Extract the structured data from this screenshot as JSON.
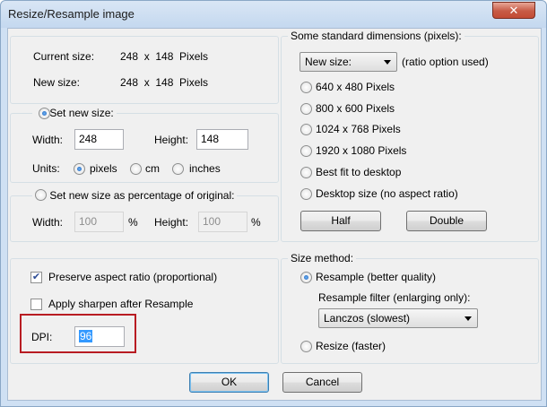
{
  "window": {
    "title": "Resize/Resample image",
    "close_label": "✕"
  },
  "size_info": {
    "current_label": "Current size:",
    "current_value": "248  x  148  Pixels",
    "new_label": "New size:",
    "new_value": "248  x  148  Pixels"
  },
  "set_new_size": {
    "title": "Set new size:",
    "width_label": "Width:",
    "width_value": "248",
    "height_label": "Height:",
    "height_value": "148",
    "units_label": "Units:",
    "units": [
      "pixels",
      "cm",
      "inches"
    ],
    "selected_unit": "pixels"
  },
  "percentage": {
    "title": "Set new size as percentage of original:",
    "width_label": "Width:",
    "width_value": "100",
    "height_label": "Height:",
    "height_value": "100",
    "percent_sign": "%"
  },
  "options": {
    "preserve_label": "Preserve aspect ratio (proportional)",
    "preserve_checked": true,
    "sharpen_label": "Apply sharpen after Resample",
    "sharpen_checked": false,
    "dpi_label": "DPI:",
    "dpi_value": "96"
  },
  "standard_dimensions": {
    "title": "Some standard dimensions (pixels):",
    "combo_value": "New size:",
    "combo_note": "(ratio option used)",
    "choices": [
      "640 x 480 Pixels",
      "800 x 600 Pixels",
      "1024 x 768 Pixels",
      "1920 x 1080 Pixels",
      "Best fit to desktop",
      "Desktop size (no aspect ratio)"
    ],
    "half_label": "Half",
    "double_label": "Double"
  },
  "size_method": {
    "title": "Size method:",
    "resample_label": "Resample (better quality)",
    "filter_label": "Resample filter (enlarging only):",
    "filter_value": "Lanczos (slowest)",
    "resize_label": "Resize (faster)",
    "selected": "resample"
  },
  "buttons": {
    "ok": "OK",
    "cancel": "Cancel"
  },
  "colors": {
    "highlight": "#b81c22",
    "selection": "#3399ff",
    "dialog_bg": "#f0f0f0"
  }
}
